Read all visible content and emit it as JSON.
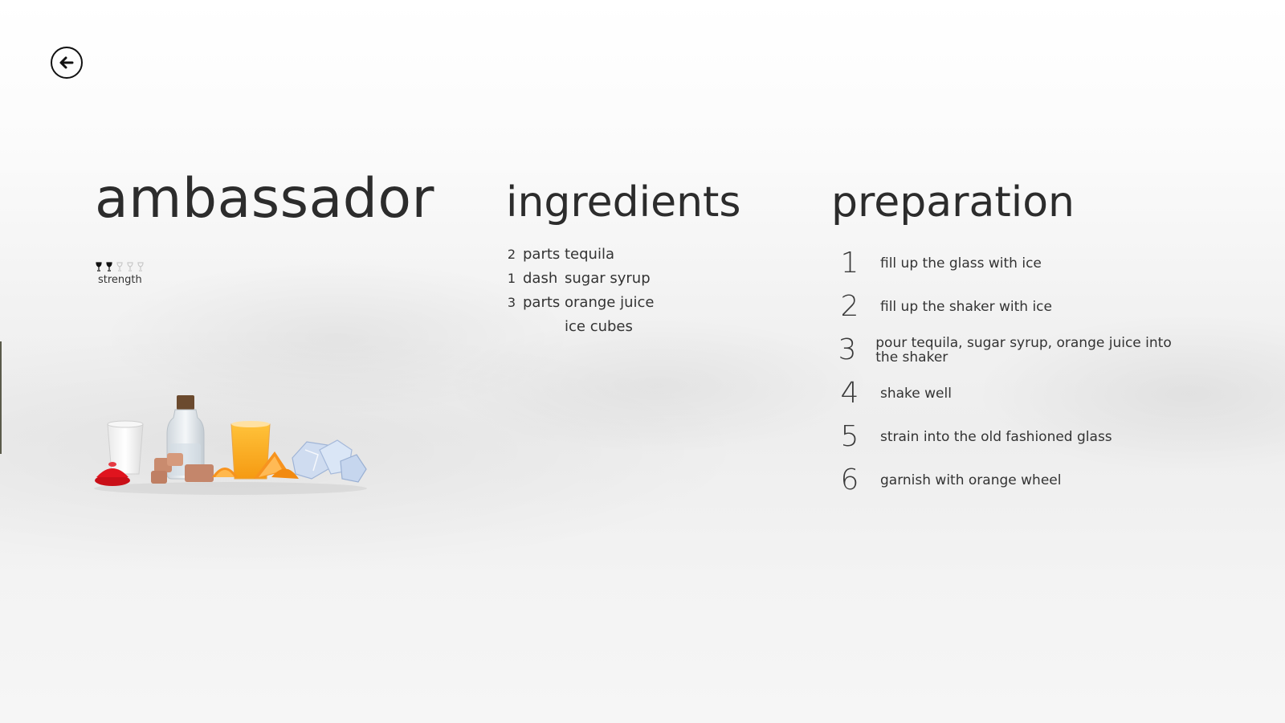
{
  "back": {
    "icon": "arrow-left-icon"
  },
  "recipe": {
    "name": "ambassador",
    "strength": {
      "label": "strength",
      "value": 2,
      "max": 5
    }
  },
  "ingredients": {
    "title": "ingredients",
    "items": [
      {
        "qty": "2",
        "unit": "parts",
        "name": "tequila"
      },
      {
        "qty": "1",
        "unit": "dash",
        "name": "sugar syrup"
      },
      {
        "qty": "3",
        "unit": "parts",
        "name": "orange juice"
      },
      {
        "qty": "",
        "unit": "",
        "name": "ice cubes"
      }
    ]
  },
  "preparation": {
    "title": "preparation",
    "steps": [
      {
        "num": "1",
        "text": "fill up the glass with ice"
      },
      {
        "num": "2",
        "text": "fill up the shaker with ice"
      },
      {
        "num": "3",
        "text": "pour tequila, sugar syrup, orange juice into the shaker"
      },
      {
        "num": "4",
        "text": "shake well"
      },
      {
        "num": "5",
        "text": "strain into the old fashioned glass"
      },
      {
        "num": "6",
        "text": "garnish with orange wheel"
      }
    ]
  },
  "colors": {
    "filled_glass": "#111111",
    "empty_glass": "#c9c9c9",
    "juicer_red": "#e0141e",
    "orange": "#f7931e"
  }
}
